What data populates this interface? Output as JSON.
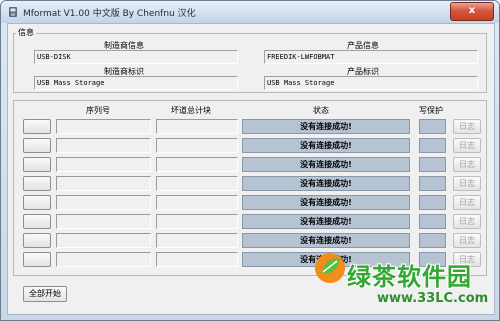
{
  "window": {
    "title": "Mformat V1.00 中文版 By Chenfnu 汉化",
    "close_label": "x"
  },
  "info": {
    "group_title": "信息",
    "vendor_info_label": "制造商信息",
    "vendor_info_value": "USB-DISK",
    "vendor_id_label": "制造商标识",
    "vendor_id_value": "USB Mass Storage",
    "product_info_label": "产品信息",
    "product_info_value": "FREEDIK-LWFOBMAT",
    "product_id_label": "产品标识",
    "product_id_value": "USB Mass Storage"
  },
  "table": {
    "headers": {
      "serial": "序列号",
      "bad_blocks": "坏道总计块",
      "status": "状态",
      "write_protect": "写保护"
    },
    "rows": [
      {
        "status": "没有连接成功!",
        "log_label": "日志"
      },
      {
        "status": "没有连接成功!",
        "log_label": "日志"
      },
      {
        "status": "没有连接成功!",
        "log_label": "日志"
      },
      {
        "status": "没有连接成功!",
        "log_label": "日志"
      },
      {
        "status": "没有连接成功!",
        "log_label": "日志"
      },
      {
        "status": "没有连接成功!",
        "log_label": "日志"
      },
      {
        "status": "没有连接成功!",
        "log_label": "日志"
      },
      {
        "status": "没有连接成功!",
        "log_label": "日志"
      }
    ]
  },
  "footer": {
    "start_all_label": "全部开始"
  },
  "watermark": {
    "brand": "绿茶软件园",
    "url": "www.33LC.com"
  }
}
